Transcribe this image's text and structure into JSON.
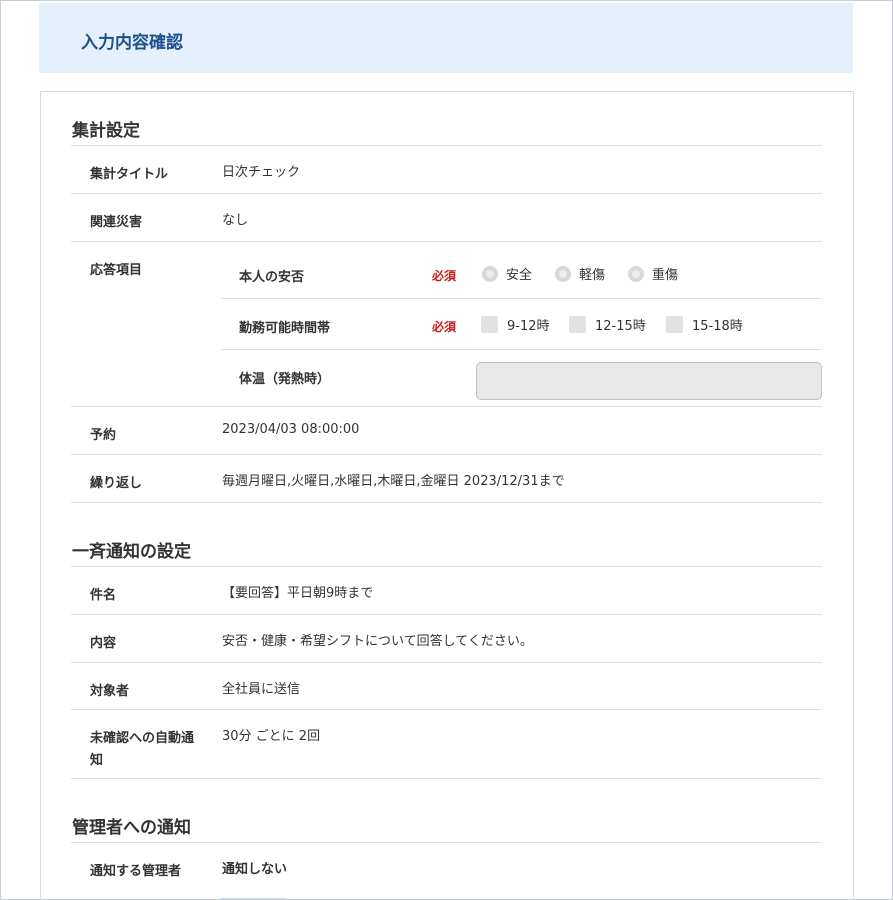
{
  "header": {
    "title": "入力内容確認"
  },
  "sections": {
    "aggregation": {
      "title": "集計設定",
      "title_label": "集計タイトル",
      "title_value": "日次チェック",
      "disaster_label": "関連災害",
      "disaster_value": "なし",
      "response_label": "応答項目",
      "items": {
        "safety": {
          "label": "本人の安否",
          "required": "必須",
          "options": [
            "安全",
            "軽傷",
            "重傷"
          ]
        },
        "hours": {
          "label": "勤務可能時間帯",
          "required": "必須",
          "options": [
            "9-12時",
            "12-15時",
            "15-18時"
          ]
        },
        "temperature": {
          "label": "体温（発熱時）",
          "value": ""
        }
      },
      "reservation_label": "予約",
      "reservation_value": "2023/04/03 08:00:00",
      "repeat_label": "繰り返し",
      "repeat_value": "毎週月曜日,火曜日,水曜日,木曜日,金曜日 2023/12/31まで"
    },
    "notification": {
      "title": "一斉通知の設定",
      "subject_label": "件名",
      "subject_value": "【要回答】平日朝9時まで",
      "content_label": "内容",
      "content_value": "安否・健康・希望シフトについて回答してください。",
      "target_label": "対象者",
      "target_value": "全社員に送信",
      "auto_label_1": "未確認への自動通",
      "auto_label_2": "知",
      "auto_value": "30分 ごとに 2回"
    },
    "admin": {
      "title": "管理者への通知",
      "admin_label": "通知する管理者",
      "admin_value": "通知しない"
    }
  }
}
